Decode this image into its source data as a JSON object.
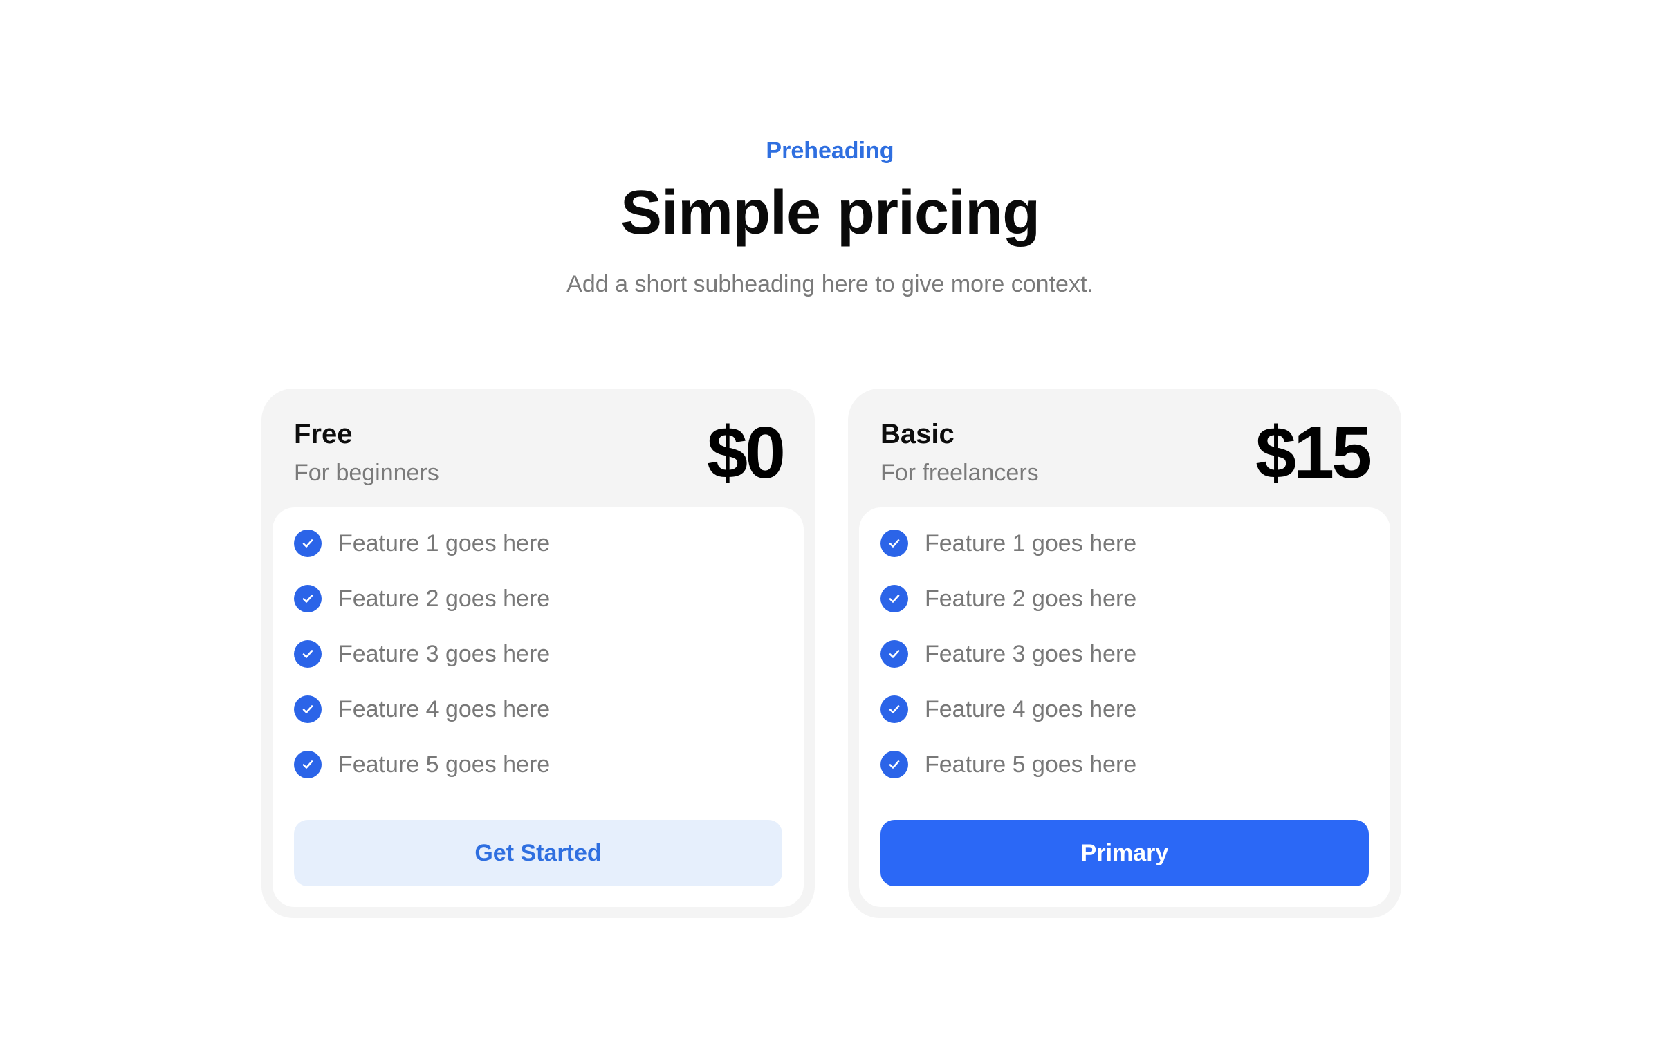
{
  "header": {
    "preheading": "Preheading",
    "title": "Simple pricing",
    "subtitle": "Add a short subheading here to give more context."
  },
  "plans": [
    {
      "name": "Free",
      "description": "For beginners",
      "price": "$0",
      "features": [
        "Feature 1 goes here",
        "Feature 2 goes here",
        "Feature 3 goes here",
        "Feature 4 goes here",
        "Feature 5 goes here"
      ],
      "button_label": "Get Started"
    },
    {
      "name": "Basic",
      "description": "For freelancers",
      "price": "$15",
      "features": [
        "Feature 1 goes here",
        "Feature 2 goes here",
        "Feature 3 goes here",
        "Feature 4 goes here",
        "Feature 5 goes here"
      ],
      "button_label": "Primary"
    }
  ],
  "icons": {
    "feature": "check-circle-icon"
  },
  "colors": {
    "accent": "#2b68f6",
    "accent_text": "#2f6fe0",
    "secondary_button_bg": "#e6effc",
    "card_bg": "#f4f4f4",
    "muted_text": "#7a7a7a"
  }
}
